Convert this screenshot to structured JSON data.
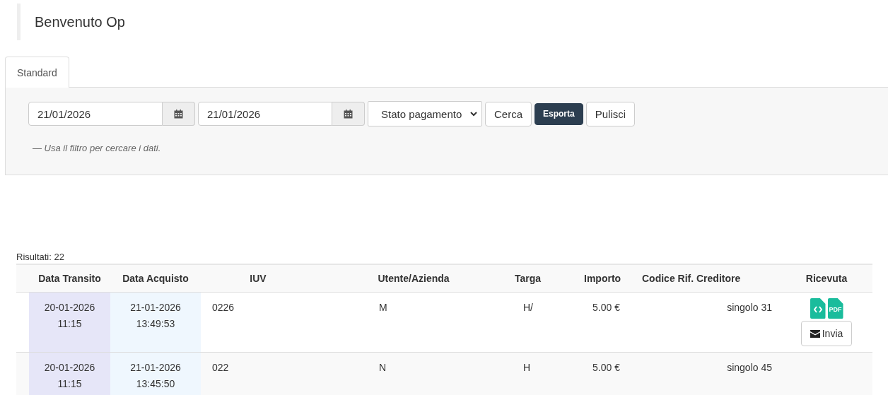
{
  "heading": "Benvenuto Op",
  "tabs": [
    {
      "label": "Standard",
      "selected": true
    }
  ],
  "filters": {
    "date_from": "21/01/2026",
    "date_to": "21/01/2026",
    "status_select": "Stato pagamento",
    "buttons": [
      {
        "label": "Cerca",
        "kind": "default"
      },
      {
        "label": "Esporta",
        "kind": "primary"
      },
      {
        "label": "Pulisci",
        "kind": "default"
      }
    ],
    "hint": "— Usa il filtro per cercare i dati."
  },
  "results_count": "Risultati: 22",
  "table": {
    "columns": [
      "Data Transito",
      "Data Acquisto",
      "IUV",
      "Utente/Azienda",
      "Targa",
      "Importo",
      "Codice Rif. Creditore",
      "Ricevuta"
    ],
    "rows": [
      {
        "transit_date": "20-01-2026",
        "transit_time": "11:15",
        "purchase_date": "21-01-2026",
        "purchase_time": "13:49:53",
        "iuv": "0226",
        "user": "M",
        "plate": "H/",
        "amount": "5.00 €",
        "creditor_ref": "singolo 31",
        "receipt": {
          "pdf_label": "PDF",
          "send_button": "Invia"
        }
      },
      {
        "transit_date": "20-01-2026",
        "transit_time": "11:15",
        "purchase_date": "21-01-2026",
        "purchase_time": "13:45:50",
        "iuv": "022",
        "user": "N",
        "plate": "H",
        "amount": "5.00 €",
        "creditor_ref": "singolo 45"
      }
    ]
  }
}
